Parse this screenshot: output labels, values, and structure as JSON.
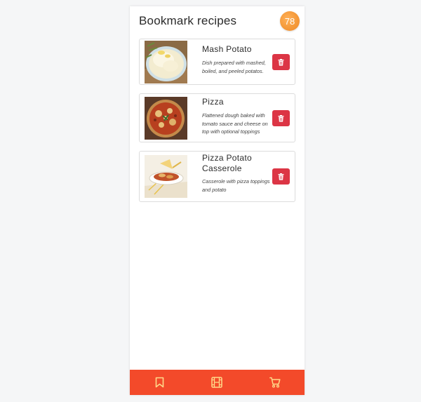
{
  "header": {
    "title": "Bookmark recipes",
    "score": "78"
  },
  "recipes": [
    {
      "name": "Mash Potato",
      "description": "Dish prepared with mashed, boiled, and peeled potatos.",
      "image": "mashed-potato-photo"
    },
    {
      "name": "Pizza",
      "description": "Flattened dough baked with tomato sauce and cheese on top with optional toppings",
      "image": "pizza-photo"
    },
    {
      "name": "Pizza Potato Casserole",
      "description": "Casserole with pizza toppings and potato",
      "image": "pizza-potato-casserole-photo"
    }
  ],
  "bottom_nav": {
    "items": [
      {
        "icon": "bookmark-icon"
      },
      {
        "icon": "film-icon"
      },
      {
        "icon": "cart-icon"
      }
    ]
  },
  "colors": {
    "accent": "#f34a2a",
    "delete": "#dc3545",
    "badge": "#f59a3a",
    "nav_icon": "#ffd98a"
  }
}
